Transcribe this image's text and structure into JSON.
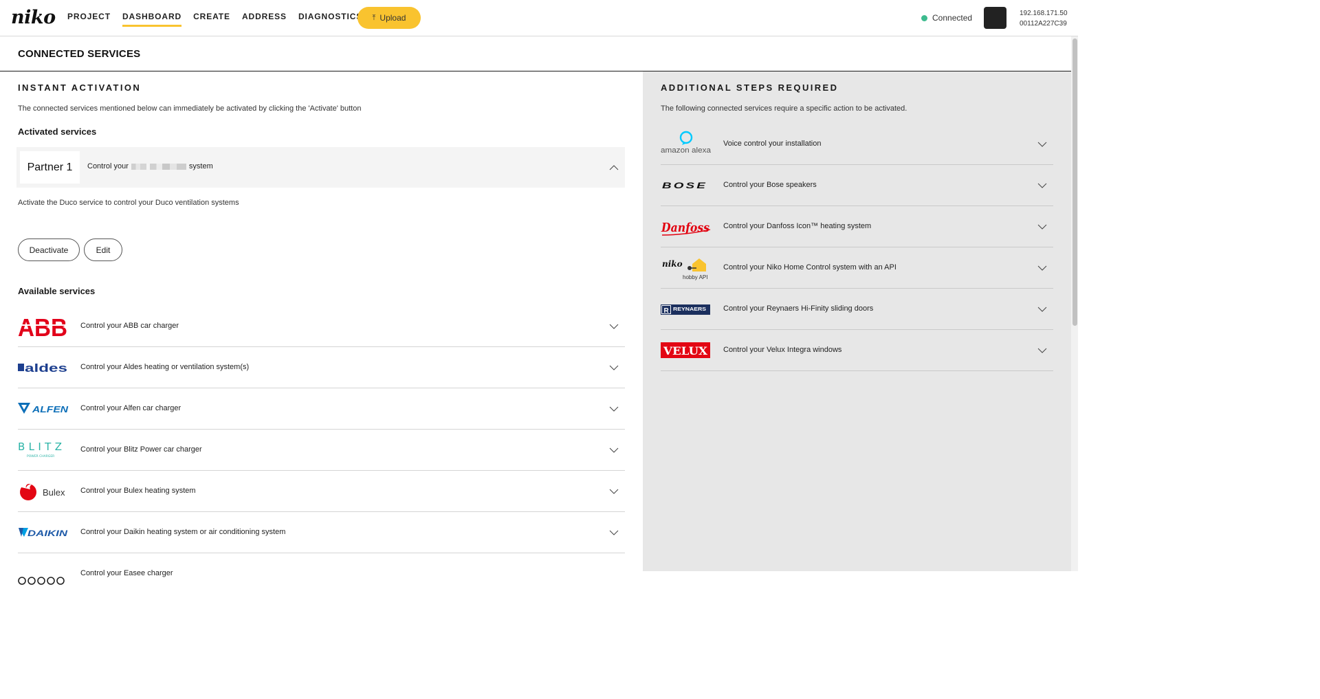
{
  "app": {
    "logo_text": "niko"
  },
  "nav": {
    "items": [
      {
        "label": "PROJECT"
      },
      {
        "label": "DASHBOARD"
      },
      {
        "label": "CREATE"
      },
      {
        "label": "ADDRESS"
      },
      {
        "label": "DIAGNOSTICS"
      }
    ],
    "active": "DASHBOARD",
    "upload_label": "Upload"
  },
  "status": {
    "label": "Connected",
    "color": "#3dbb8e"
  },
  "device": {
    "ip": "192.168.171.50",
    "id": "00112A227C39"
  },
  "colors": {
    "accent": "#f9c32f",
    "right_panel_bg": "#e7e7e7"
  },
  "page": {
    "title": "CONNECTED SERVICES"
  },
  "instant": {
    "heading": "INSTANT ACTIVATION",
    "description": "The connected services mentioned below can immediately be activated by clicking the 'Activate' button",
    "activated_heading": "Activated services",
    "activated": {
      "logo_text": "Partner 1",
      "text_before": "Control your",
      "text_after": "system",
      "detail": "Activate the Duco service to control your Duco ventilation systems",
      "deactivate_label": "Deactivate",
      "edit_label": "Edit"
    },
    "available_heading": "Available services",
    "available": [
      {
        "logo": "ABB",
        "text": "Control your ABB car charger"
      },
      {
        "logo": "aldes",
        "text": "Control your Aldes heating or ventilation system(s)"
      },
      {
        "logo": "ALFEN",
        "text": "Control your Alfen car charger"
      },
      {
        "logo": "BLITZ",
        "logo_sub": "POWER CHARGER",
        "text": "Control your Blitz Power car charger"
      },
      {
        "logo": "Bulex",
        "text": "Control your Bulex heating system"
      },
      {
        "logo": "DAIKIN",
        "text": "Control your Daikin heating system or air conditioning system"
      },
      {
        "logo": "",
        "text": "Control your Easee charger"
      }
    ]
  },
  "additional": {
    "heading": "ADDITIONAL STEPS REQUIRED",
    "description": "The following connected services require a specific action to be activated.",
    "services": [
      {
        "logo": "amazon alexa",
        "text": "Voice control your installation"
      },
      {
        "logo": "BOSE",
        "text": "Control your Bose speakers"
      },
      {
        "logo": "Danfoss",
        "text": "Control your Danfoss Icon™ heating system"
      },
      {
        "logo": "niko",
        "logo_sub": "hobby API",
        "text": "Control your Niko Home Control system with an API"
      },
      {
        "logo": "REYNAERS",
        "text": "Control your Reynaers Hi-Finity sliding doors"
      },
      {
        "logo": "VELUX",
        "text": "Control your Velux Integra windows"
      }
    ]
  }
}
